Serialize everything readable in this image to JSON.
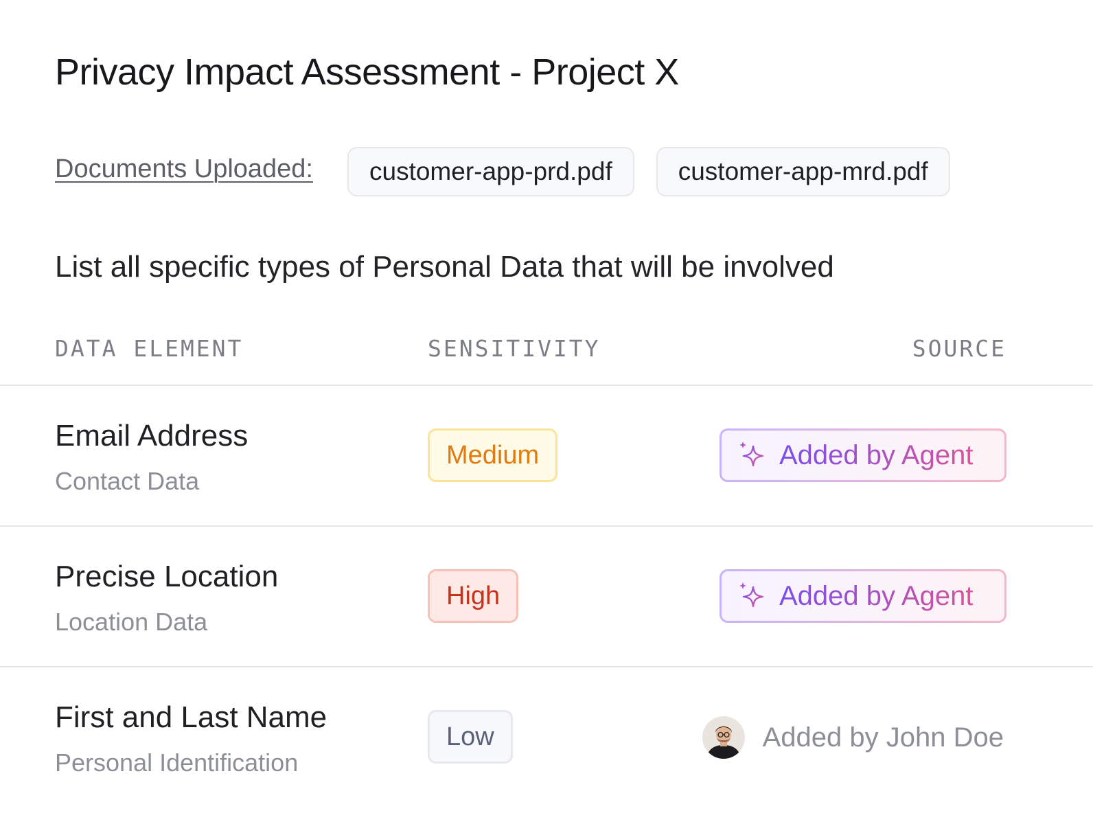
{
  "title": "Privacy Impact Assessment - Project X",
  "documents": {
    "label": "Documents Uploaded:",
    "files": [
      "customer-app-prd.pdf",
      "customer-app-mrd.pdf"
    ]
  },
  "question": "List all specific types of Personal Data that will be involved",
  "table": {
    "headers": [
      "DATA ELEMENT",
      "SENSITIVITY",
      "SOURCE"
    ],
    "rows": [
      {
        "element": "Email Address",
        "category": "Contact Data",
        "sensitivity": "Medium",
        "source": "Added by Agent",
        "source_icon": "sparkle-icon"
      },
      {
        "element": "Precise Location",
        "category": "Location Data",
        "sensitivity": "High",
        "source": "Added by Agent",
        "source_icon": "sparkle-icon"
      },
      {
        "element": "First and Last Name",
        "category": "Personal Identification",
        "sensitivity": "Low",
        "source": "Added by John Doe",
        "source_icon": "avatar"
      }
    ]
  },
  "colors": {
    "medium": "#e27a12",
    "high": "#c6321c",
    "low": "#5a6078",
    "agent_gradient": [
      "#7b4fe8",
      "#d6549a"
    ]
  }
}
